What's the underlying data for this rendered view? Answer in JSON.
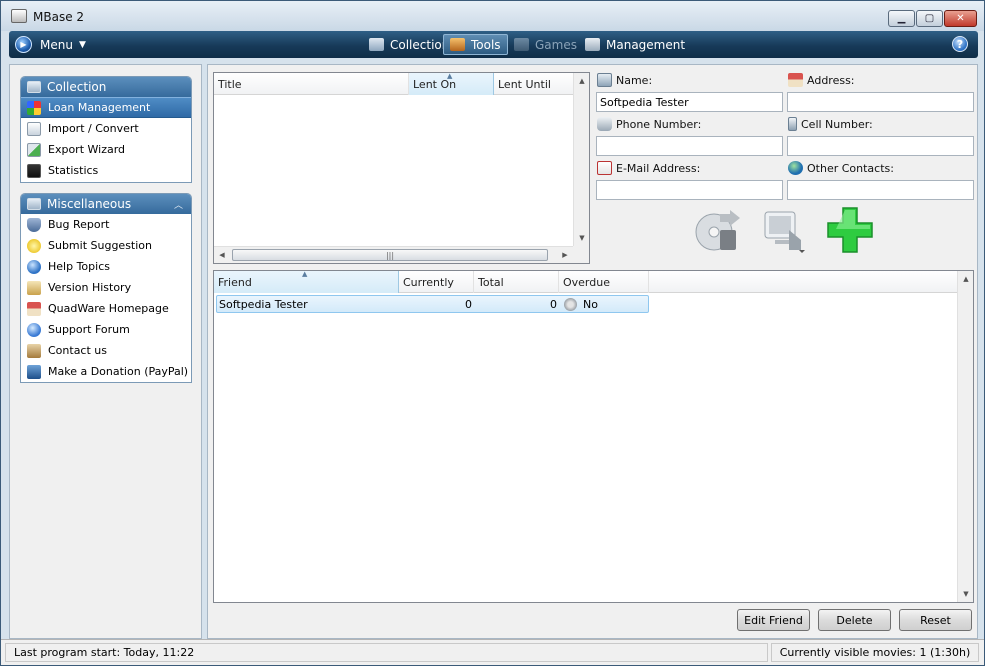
{
  "window": {
    "title": "MBase 2"
  },
  "menubar": {
    "menu_label": "Menu",
    "tabs": [
      {
        "label": "Collection",
        "state": "normal"
      },
      {
        "label": "Tools",
        "state": "active"
      },
      {
        "label": "Games",
        "state": "disabled"
      },
      {
        "label": "Management",
        "state": "normal"
      }
    ],
    "help_glyph": "?"
  },
  "sidebar": {
    "collection_group": {
      "title": "Collection",
      "items": [
        {
          "label": "Loan Management",
          "selected": true,
          "icon": "loan-icon"
        },
        {
          "label": "Import / Convert",
          "selected": false,
          "icon": "import-icon"
        },
        {
          "label": "Export Wizard",
          "selected": false,
          "icon": "export-icon"
        },
        {
          "label": "Statistics",
          "selected": false,
          "icon": "statistics-icon"
        }
      ]
    },
    "misc_group": {
      "title": "Miscellaneous",
      "items": [
        {
          "label": "Bug Report",
          "icon": "bug-icon"
        },
        {
          "label": "Submit Suggestion",
          "icon": "suggestion-icon"
        },
        {
          "label": "Help Topics",
          "icon": "help-topics-icon"
        },
        {
          "label": "Version History",
          "icon": "history-icon"
        },
        {
          "label": "QuadWare Homepage",
          "icon": "home-icon"
        },
        {
          "label": "Support Forum",
          "icon": "info-icon"
        },
        {
          "label": "Contact us",
          "icon": "contact-icon"
        },
        {
          "label": "Make a Donation (PayPal)",
          "icon": "donation-icon"
        }
      ]
    }
  },
  "loans_table": {
    "columns": [
      "Title",
      "Lent On",
      "Lent Until"
    ],
    "sorted_column": "Lent On",
    "rows": []
  },
  "form": {
    "name_label": "Name:",
    "name_value": "Softpedia Tester",
    "address_label": "Address:",
    "address_value": "",
    "phone_label": "Phone Number:",
    "phone_value": "",
    "cell_label": "Cell Number:",
    "cell_value": "",
    "email_label": "E-Mail Address:",
    "email_value": "",
    "other_label": "Other Contacts:",
    "other_value": ""
  },
  "friends_table": {
    "columns": [
      "Friend",
      "Currently",
      "Total",
      "Overdue"
    ],
    "sorted_column": "Friend",
    "rows": [
      {
        "friend": "Softpedia Tester",
        "currently": "0",
        "total": "0",
        "overdue": "No"
      }
    ]
  },
  "buttons": {
    "edit_friend": "Edit Friend",
    "delete": "Delete",
    "reset": "Reset"
  },
  "statusbar": {
    "left": "Last program start: Today, 11:22",
    "right": "Currently visible movies: 1 (1:30h)"
  },
  "colors": {
    "menubar": "#173a59",
    "selection": "#2f6aa6",
    "add_icon": "#2ecc40"
  }
}
